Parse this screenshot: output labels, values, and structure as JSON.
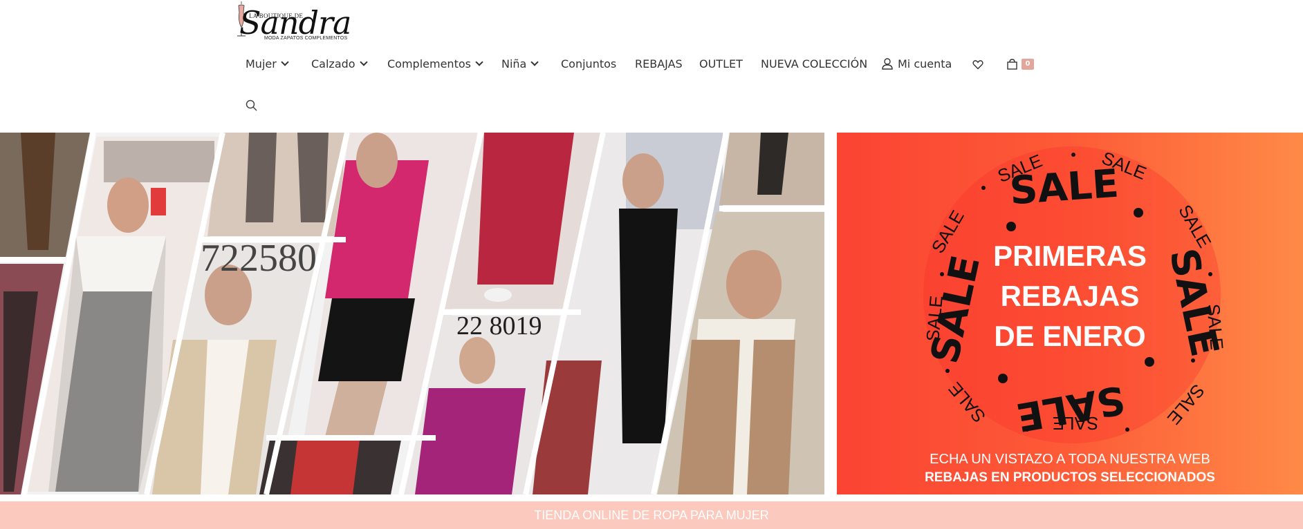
{
  "logo": {
    "line1": "LA BOUTIQUE DE",
    "script": "Sandra",
    "line2": "MODA ZAPATOS COMPLEMENTOS"
  },
  "nav": {
    "items": [
      {
        "label": "Mujer",
        "dropdown": true
      },
      {
        "label": "Calzado",
        "dropdown": true
      },
      {
        "label": "Complementos",
        "dropdown": true
      },
      {
        "label": "Niña",
        "dropdown": true
      },
      {
        "label": "Conjuntos",
        "dropdown": false
      },
      {
        "label": "REBAJAS",
        "dropdown": false
      },
      {
        "label": "OUTLET",
        "dropdown": false
      },
      {
        "label": "NUEVA COLECCIÓN",
        "dropdown": false
      }
    ],
    "account_label": "Mi cuenta",
    "cart_count": "0"
  },
  "hero": {
    "sale_word": "SALE",
    "headline": [
      "PRIMERAS",
      "REBAJAS",
      "DE ENERO"
    ],
    "subline1": "ECHA UN VISTAZO A TODA NUESTRA WEB",
    "subline2": "REBAJAS EN PRODUCTOS SELECCIONADOS",
    "collage_numbers": [
      "722580",
      "22 8019"
    ]
  },
  "footer": {
    "tagline": "TIENDA ONLINE DE ROPA PARA MUJER"
  },
  "colors": {
    "accent": "#e4a59a",
    "sale_red": "#fb4333",
    "sale_orange": "#fe8a47",
    "footer_bar": "#fbc9bd"
  },
  "icons": [
    "user-icon",
    "heart-icon",
    "cart-icon",
    "search-icon",
    "chevron-down-icon"
  ]
}
